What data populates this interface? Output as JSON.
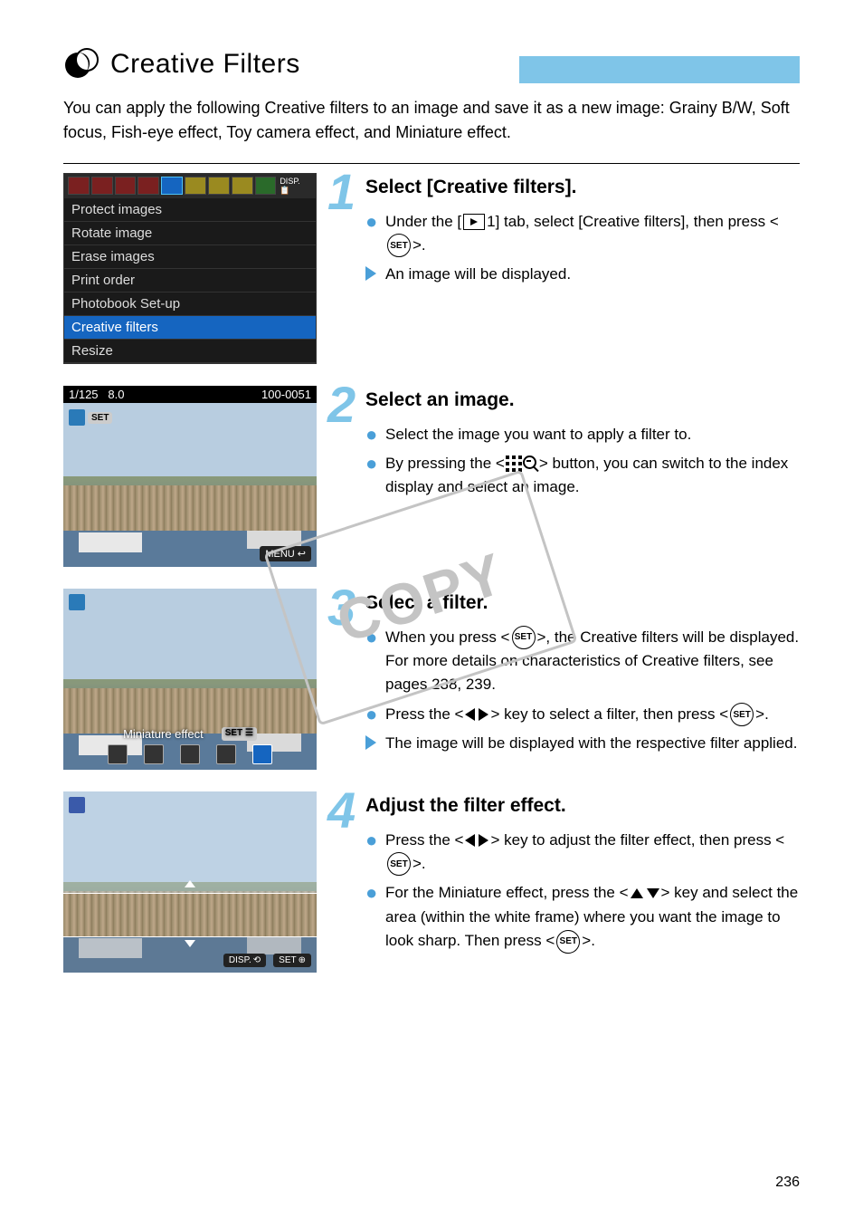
{
  "header": {
    "title": "Creative Filters"
  },
  "intro": "You can apply the following Creative filters to an image and save it as a new image: Grainy B/W, Soft focus, Fish-eye effect, Toy camera effect, and Miniature effect.",
  "menu": {
    "items": [
      "Protect images",
      "Rotate image",
      "Erase images",
      "Print order",
      "Photobook Set-up",
      "Creative filters",
      "Resize"
    ]
  },
  "thumb2": {
    "shutter": "1/125",
    "aperture": "8.0",
    "filecode": "100-0051",
    "set_label": "SET",
    "menu_label": "MENU"
  },
  "thumb3": {
    "filter_label": "Miniature effect",
    "set_label": "SET"
  },
  "thumb4": {
    "disp_label": "DISP.",
    "set_label": "SET"
  },
  "steps": {
    "s1": {
      "num": "1",
      "title": "Select [Creative filters].",
      "b1a": "Under the [",
      "b1b": "1] tab, select [Creative filters], then press <",
      "b1c": ">.",
      "b2": "An image will be displayed."
    },
    "s2": {
      "num": "2",
      "title": "Select an image.",
      "b1": "Select the image you want to apply a filter to.",
      "b2a": "By pressing the <",
      "b2b": "> button, you can switch to the index display and select an image."
    },
    "s3": {
      "num": "3",
      "title": "Select a filter.",
      "b1a": "When you press <",
      "b1b": ">, the Creative filters will be displayed.",
      "b1c": "For more details on characteristics of Creative filters, see pages 238, 239.",
      "b2a": "Press the <",
      "b2b": "> key to select a filter, then press <",
      "b2c": ">.",
      "b3": "The image will be displayed with the respective filter applied."
    },
    "s4": {
      "num": "4",
      "title": "Adjust the filter effect.",
      "b1a": "Press the <",
      "b1b": "> key to adjust the filter effect, then press <",
      "b1c": ">.",
      "b2a": "For the Miniature effect, press the <",
      "b2b": "> key and select the area (within the white frame) where you want the image to look sharp. Then press <",
      "b2c": ">."
    }
  },
  "set_label": "SET",
  "page_number": "236"
}
